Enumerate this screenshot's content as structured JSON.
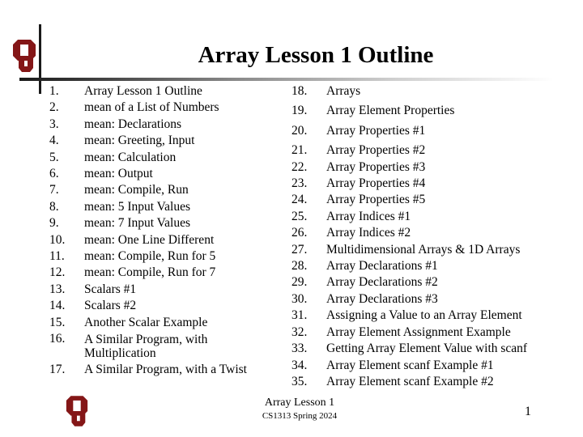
{
  "slide": {
    "title": "Array Lesson 1 Outline",
    "logo": "ou-logo",
    "logo_color": "#841617",
    "left_items": [
      {
        "num": "1.",
        "text": "Array Lesson 1 Outline"
      },
      {
        "num": "2.",
        "text": "mean of a List of Numbers"
      },
      {
        "num": "3.",
        "text": "mean: Declarations"
      },
      {
        "num": "4.",
        "text": "mean: Greeting, Input"
      },
      {
        "num": "5.",
        "text": "mean: Calculation"
      },
      {
        "num": "6.",
        "text": "mean: Output"
      },
      {
        "num": "7.",
        "text": "mean: Compile, Run"
      },
      {
        "num": "8.",
        "text": "mean: 5 Input Values"
      },
      {
        "num": "9.",
        "text": "mean: 7 Input Values"
      },
      {
        "num": "10.",
        "text": "mean: One Line Different"
      },
      {
        "num": "11.",
        "text": "mean: Compile, Run for 5"
      },
      {
        "num": "12.",
        "text": "mean: Compile, Run for 7"
      },
      {
        "num": "13.",
        "text": "Scalars #1"
      },
      {
        "num": "14.",
        "text": "Scalars #2"
      },
      {
        "num": "15.",
        "text": "Another Scalar Example"
      },
      {
        "num": "16.",
        "text": "A Similar Program, with Multiplication"
      },
      {
        "num": "17.",
        "text": "A Similar Program, with a Twist"
      }
    ],
    "right_items": [
      {
        "num": "18.",
        "text": "Arrays"
      },
      {
        "num": "19.",
        "text": "Array Element Properties"
      },
      {
        "num": "20.",
        "text": "Array Properties #1"
      },
      {
        "num": "21.",
        "text": "Array Properties #2"
      },
      {
        "num": "22.",
        "text": "Array Properties #3"
      },
      {
        "num": "23.",
        "text": "Array Properties #4"
      },
      {
        "num": "24.",
        "text": "Array Properties #5"
      },
      {
        "num": "25.",
        "text": "Array Indices #1"
      },
      {
        "num": "26.",
        "text": "Array Indices #2"
      },
      {
        "num": "27.",
        "text": "Multidimensional Arrays & 1D Arrays"
      },
      {
        "num": "28.",
        "text": "Array Declarations #1"
      },
      {
        "num": "29.",
        "text": "Array Declarations #2"
      },
      {
        "num": "30.",
        "text": "Array Declarations #3"
      },
      {
        "num": "31.",
        "text": "Assigning a Value to an Array Element"
      },
      {
        "num": "32.",
        "text": "Array Element Assignment Example"
      },
      {
        "num": "33.",
        "text": "Getting Array Element Value with scanf"
      },
      {
        "num": "34.",
        "text": "Array Element scanf Example #1"
      },
      {
        "num": "35.",
        "text": "Array Element scanf Example #2"
      }
    ]
  },
  "footer": {
    "title": "Array Lesson 1",
    "subtitle": "CS1313 Spring 2024",
    "page_number": "1"
  }
}
